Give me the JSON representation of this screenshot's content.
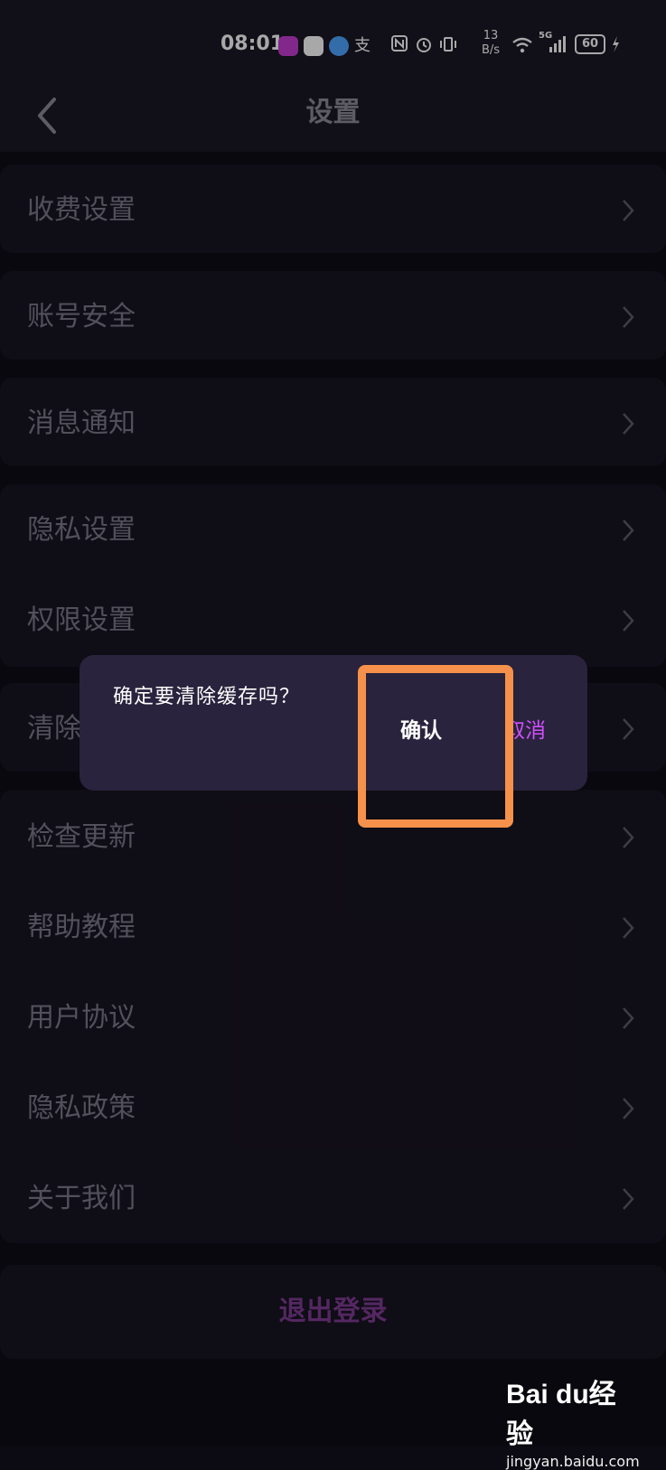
{
  "status_bar": {
    "time": "08:01",
    "net_speed_value": "13",
    "net_speed_unit": "B/s",
    "network": "5G",
    "battery": "60",
    "app_icons": [
      "app-a-icon",
      "app-b-icon",
      "app-c-icon",
      "alipay-icon"
    ],
    "app_colors": [
      "#c53bd0",
      "#ffffff",
      "#4aa3ff"
    ],
    "alipay_glyph": "支",
    "system_icons": [
      "nfc-icon",
      "alarm-icon",
      "vibrate-icon",
      "wifi-icon",
      "signal-icon",
      "battery-icon",
      "charging-icon"
    ]
  },
  "header": {
    "title": "设置",
    "back_icon": "chevron-left-icon"
  },
  "settings": {
    "items": [
      {
        "label": "收费设置"
      },
      {
        "label": "账号安全"
      },
      {
        "label": "消息通知"
      },
      {
        "label": "隐私设置"
      },
      {
        "label": "权限设置"
      },
      {
        "label": "清除缓存"
      },
      {
        "label": "检查更新"
      },
      {
        "label": "帮助教程"
      },
      {
        "label": "用户协议"
      },
      {
        "label": "隐私政策"
      },
      {
        "label": "关于我们"
      }
    ],
    "chevron_icon": "chevron-right-icon",
    "logout": "退出登录"
  },
  "dialog": {
    "message": "确定要清除缓存吗？",
    "confirm": "确认",
    "cancel": "取消"
  },
  "watermark": {
    "brand": "Bai du经验",
    "url": "jingyan.baidu.com"
  },
  "colors": {
    "background": "#0c0a12",
    "card": "#15121d",
    "dialog": "#29233d",
    "accent_cancel": "#d24fff",
    "logout": "#7e3a92",
    "highlight": "#f5914a"
  }
}
